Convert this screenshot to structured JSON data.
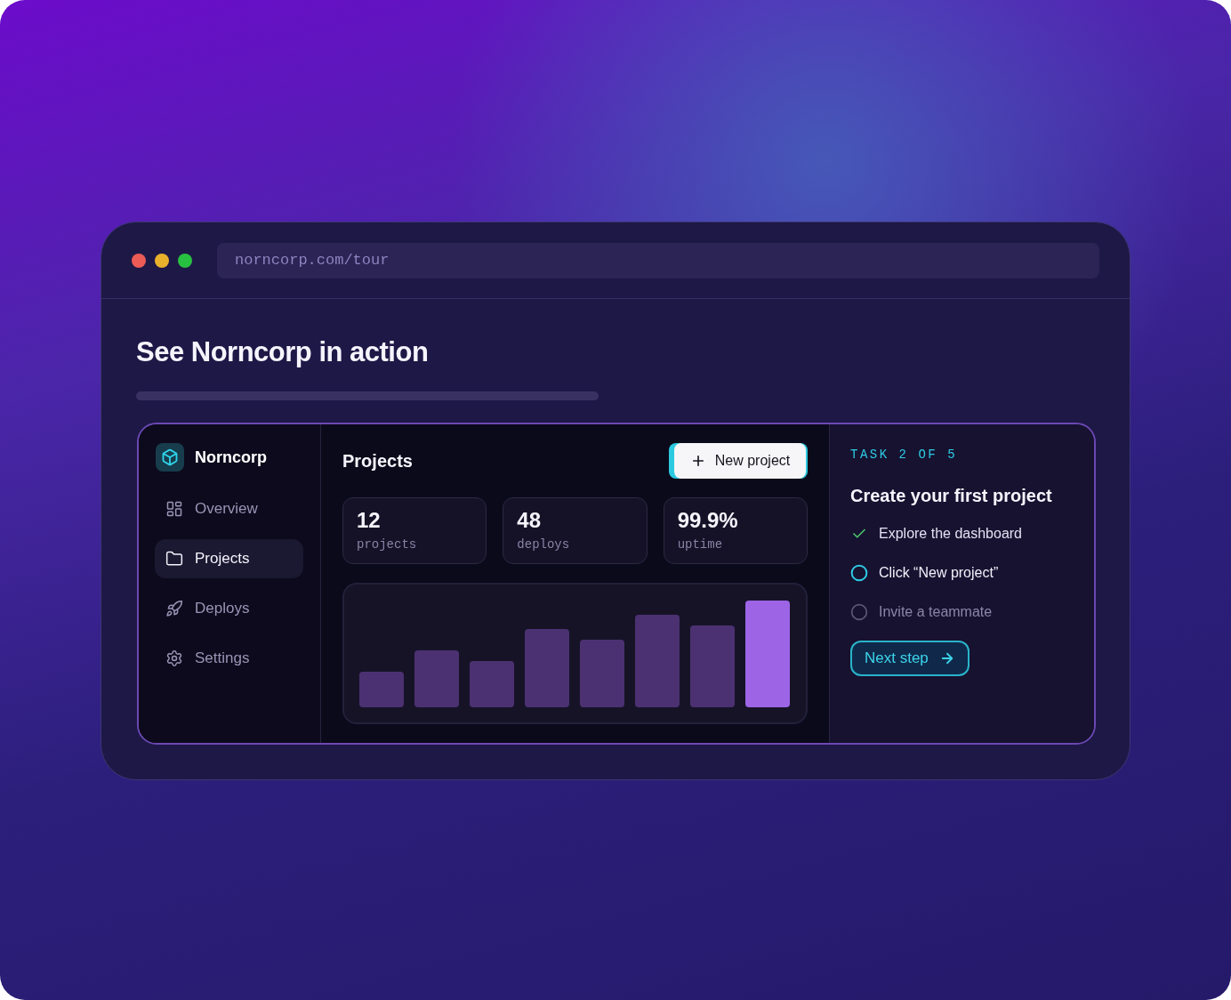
{
  "browser": {
    "url": "norncorp.com/tour"
  },
  "heading": "See Norncorp in action",
  "app": {
    "sidebar": {
      "brand": "Norncorp",
      "items": [
        {
          "label": "Overview",
          "selected": false
        },
        {
          "label": "Projects",
          "selected": true
        },
        {
          "label": "Deploys",
          "selected": false
        },
        {
          "label": "Settings",
          "selected": false
        }
      ]
    },
    "main": {
      "title": "Projects",
      "new_project_button": {
        "label": "New project",
        "highlighted": true
      },
      "stats": [
        {
          "value": "12",
          "label": "projects"
        },
        {
          "value": "48",
          "label": "deploys"
        },
        {
          "value": "99.9%",
          "label": "uptime"
        }
      ]
    },
    "tour": {
      "step": "TASK 2 OF 5",
      "title": "Create your first project",
      "tasks": [
        {
          "label": "Explore the dashboard",
          "checked": true,
          "active": false
        },
        {
          "label": "Click “New project”",
          "checked": false,
          "active": true
        },
        {
          "label": "Invite a teammate",
          "checked": false,
          "active": false
        }
      ],
      "next_button": "Next step"
    }
  }
}
